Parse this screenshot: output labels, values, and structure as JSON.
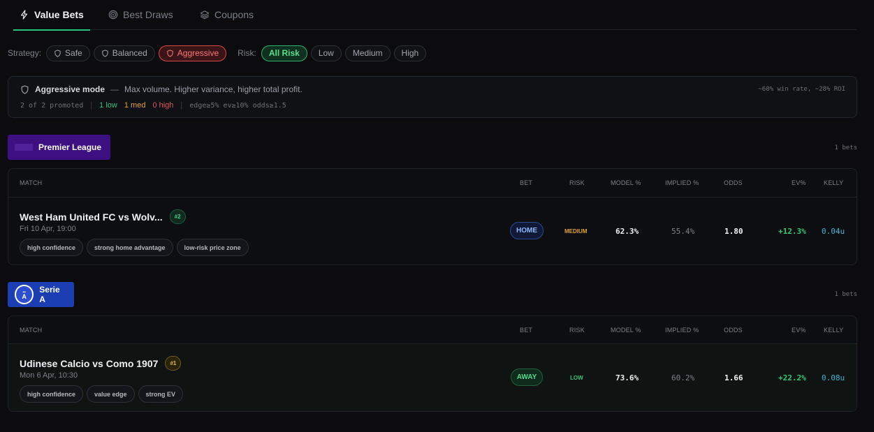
{
  "tabs": [
    {
      "label": "Value Bets",
      "icon": "lightning-icon",
      "active": true
    },
    {
      "label": "Best Draws",
      "icon": "target-icon",
      "active": false
    },
    {
      "label": "Coupons",
      "icon": "layers-icon",
      "active": false
    }
  ],
  "filters": {
    "strategy_label": "Strategy:",
    "strategies": [
      "Safe",
      "Balanced",
      "Aggressive"
    ],
    "active_strategy": "Aggressive",
    "risk_label": "Risk:",
    "risks": [
      "All Risk",
      "Low",
      "Medium",
      "High"
    ],
    "active_risk": "All Risk"
  },
  "mode": {
    "title": "Aggressive mode",
    "dash": "—",
    "description": "Max volume. Higher variance, higher total profit.",
    "stats_right": "~60% win rate, ~28% ROI",
    "promoted": "2 of 2 promoted",
    "low": "1 low",
    "med": "1 med",
    "high": "0 high",
    "criteria": "edge≥5% ev≥10% odds≥1.5"
  },
  "columns": {
    "match": "MATCH",
    "bet": "BET",
    "risk": "RISK",
    "model": "MODEL %",
    "implied": "IMPLIED %",
    "odds": "ODDS",
    "ev": "EV%",
    "kelly": "KELLY"
  },
  "leagues": [
    {
      "name": "Premier League",
      "bets_count": "1 bets",
      "matches": [
        {
          "name": "West Ham United FC vs Wolv...",
          "rank": "#2",
          "date": "Fri 10 Apr, 19:00",
          "tags": [
            "high confidence",
            "strong home advantage",
            "low-risk price zone"
          ],
          "bet": "HOME",
          "risk": "MEDIUM",
          "model": "62.3%",
          "implied": "55.4%",
          "odds": "1.80",
          "ev": "+12.3%",
          "kelly": "0.04u"
        }
      ]
    },
    {
      "name": "Serie A",
      "logo_text": "A",
      "bets_count": "1 bets",
      "matches": [
        {
          "name": "Udinese Calcio vs Como 1907",
          "rank": "#1",
          "date": "Mon 6 Apr, 10:30",
          "tags": [
            "high confidence",
            "value edge",
            "strong EV"
          ],
          "bet": "AWAY",
          "risk": "LOW",
          "model": "73.6%",
          "implied": "60.2%",
          "odds": "1.66",
          "ev": "+22.2%",
          "kelly": "0.08u"
        }
      ]
    }
  ],
  "colors": {
    "accent_green": "#25c483",
    "risk_medium": "#e2a43a",
    "risk_low": "#35c27c",
    "aggressive": "#ff7a7a",
    "premier_league": "#3d0f80",
    "serie_a": "#1b3fb3"
  }
}
